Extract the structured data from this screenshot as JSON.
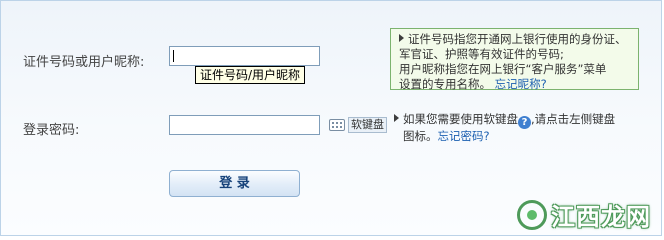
{
  "form": {
    "id_label": "证件号码或用户昵称:",
    "id_value": "",
    "id_tooltip": "证件号码/用户昵称",
    "password_label": "登录密码:",
    "password_value": "",
    "soft_keyboard_label": "软键盘",
    "login_button": "登 录"
  },
  "info_box": {
    "line1": "证件号码指您开通网上银行使用的身份证、",
    "line2": "军官证、护照等有效证件的号码;",
    "line3": "用户昵称指您在网上银行“客户服务”菜单",
    "line4_text": "设置的专用名称。",
    "forgot_nickname": "忘记昵称?"
  },
  "password_hint": {
    "text_before": "如果您需要使用软键盘",
    "text_after": ",请点击左侧键盘",
    "line2_text": "图标。",
    "forgot_password": "忘记密码?"
  },
  "watermark": {
    "text": "江西龙网"
  },
  "colors": {
    "panel_border": "#bcd3e8",
    "link": "#1c5fb0",
    "info_border": "#7cb36e",
    "info_bg": "#f3fbea",
    "button_text": "#16427a"
  },
  "icons": [
    "arrow-right-icon",
    "keyboard-icon",
    "help-icon",
    "watermark-logo-icon"
  ]
}
